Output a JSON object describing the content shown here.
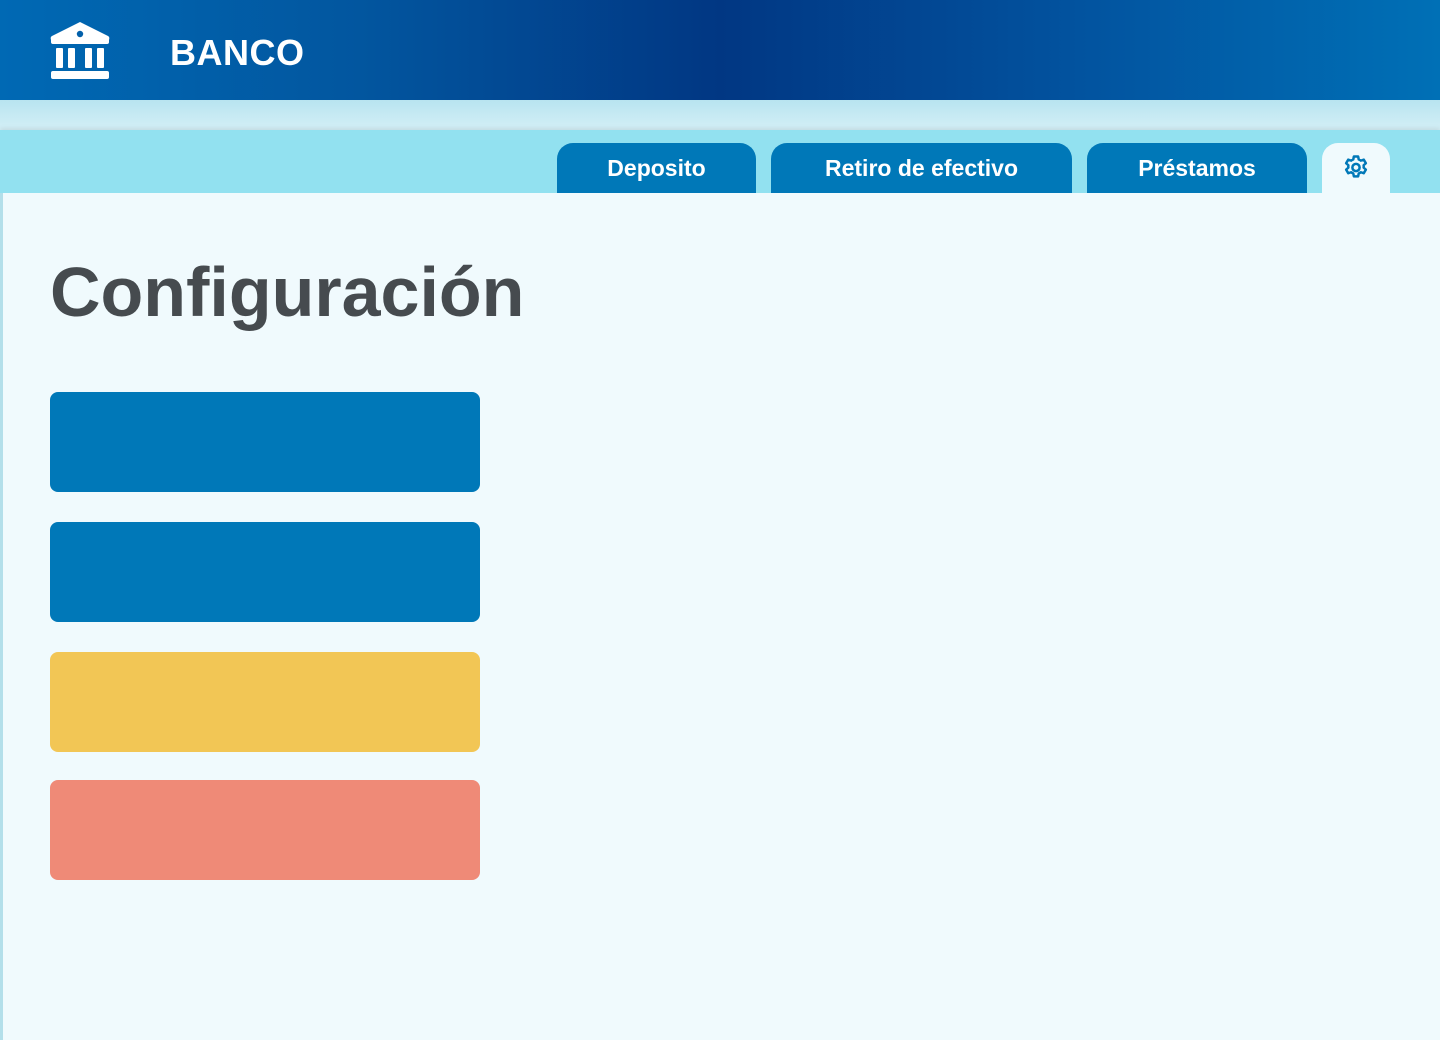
{
  "header": {
    "brand": "BANCO",
    "logo_icon": "bank-building-icon"
  },
  "tabs": [
    {
      "label": "Deposito"
    },
    {
      "label": "Retiro de efectivo"
    },
    {
      "label": "Préstamos"
    }
  ],
  "settings_tab": {
    "icon": "gear-icon",
    "active": true
  },
  "page": {
    "title": "Configuración"
  },
  "option_buttons": [
    {
      "label": "",
      "color": "#0078b8"
    },
    {
      "label": "",
      "color": "#0078b8"
    },
    {
      "label": "",
      "color": "#f2c655"
    },
    {
      "label": "",
      "color": "#ef8a77"
    }
  ],
  "colors": {
    "header_dark": "#013783",
    "header_light": "#0070b6",
    "tab_blue": "#0078b8",
    "tabbar_bg": "#92e1f0",
    "content_bg": "#f0fafd",
    "title_text": "#464b4f"
  }
}
